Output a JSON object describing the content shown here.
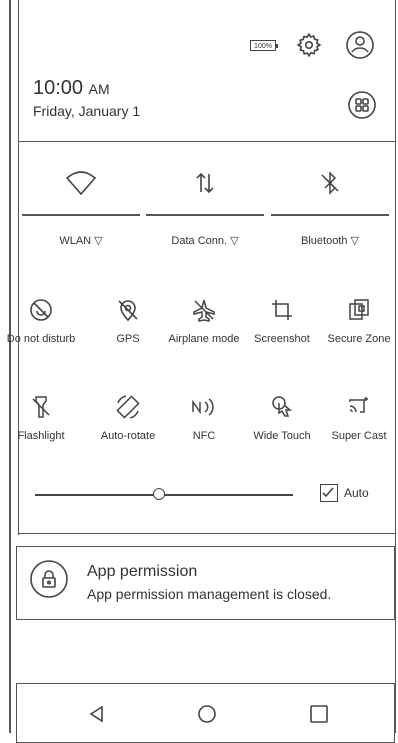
{
  "header": {
    "battery_label": "100%",
    "time": "10:00",
    "ampm": "AM",
    "date": "Friday, January 1",
    "icons": [
      "settings-icon",
      "account-icon",
      "grid-icon"
    ]
  },
  "toggles_primary": [
    {
      "label": "WLAN",
      "icon": "wifi-icon"
    },
    {
      "label": "Data Conn.",
      "icon": "data-connection-icon"
    },
    {
      "label": "Bluetooth",
      "icon": "bluetooth-icon"
    }
  ],
  "tiles": [
    {
      "label": "Do not disturb",
      "icon": "do-not-disturb-icon"
    },
    {
      "label": "GPS",
      "icon": "gps-icon"
    },
    {
      "label": "Airplane mode",
      "icon": "airplane-icon"
    },
    {
      "label": "Screenshot",
      "icon": "screenshot-icon"
    },
    {
      "label": "Secure Zone",
      "icon": "secure-zone-icon"
    },
    {
      "label": "Flashlight",
      "icon": "flashlight-icon"
    },
    {
      "label": "Auto-rotate",
      "icon": "auto-rotate-icon"
    },
    {
      "label": "NFC",
      "icon": "nfc-icon"
    },
    {
      "label": "Wide Touch",
      "icon": "wide-touch-icon"
    },
    {
      "label": "Super Cast",
      "icon": "super-cast-icon"
    }
  ],
  "brightness": {
    "level": 0.48,
    "auto_label": "Auto",
    "auto_checked": true
  },
  "notification": {
    "title": "App permission",
    "body": "App permission management is closed."
  },
  "navbar": [
    "back-icon",
    "home-icon",
    "recents-icon"
  ]
}
